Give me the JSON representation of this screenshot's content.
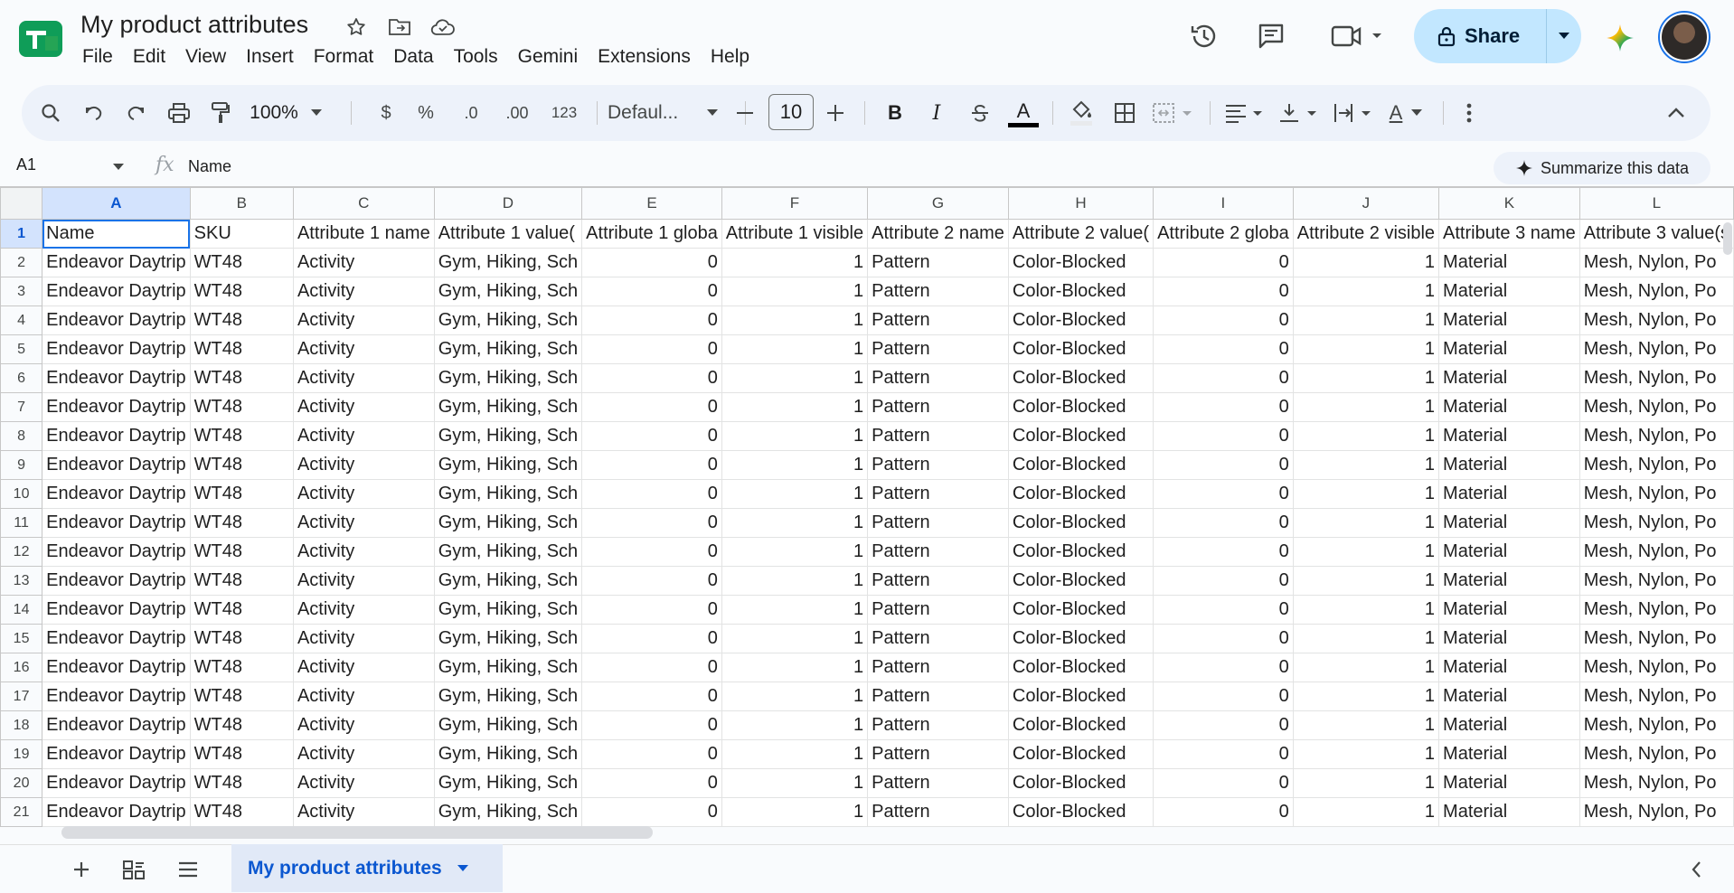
{
  "app": {
    "doc_title": "My product attributes",
    "menu": [
      "File",
      "Edit",
      "View",
      "Insert",
      "Format",
      "Data",
      "Tools",
      "Gemini",
      "Extensions",
      "Help"
    ],
    "share_label": "Share"
  },
  "toolbar": {
    "zoom": "100%",
    "currency": "$",
    "percent": "%",
    "dec_decrease": ".0",
    "dec_increase": ".00",
    "number_format": "123",
    "font": "Defaul...",
    "font_size": "10",
    "bold": "B",
    "italic": "I",
    "text_color_glyph": "A",
    "text_rotation_glyph": "A"
  },
  "formula_bar": {
    "cell_ref": "A1",
    "fx": "fx",
    "content": "Name",
    "summarize_label": "Summarize this data"
  },
  "grid": {
    "columns": [
      "A",
      "B",
      "C",
      "D",
      "E",
      "F",
      "G",
      "H",
      "I",
      "J",
      "K",
      "L"
    ],
    "header_row": [
      "Name",
      "SKU",
      "Attribute 1 name",
      "Attribute 1 value(",
      "Attribute 1 globa",
      "Attribute 1 visible",
      "Attribute 2 name",
      "Attribute 2 value(",
      "Attribute 2 globa",
      "Attribute 2 visible",
      "Attribute 3 name",
      "Attribute 3 value(s"
    ],
    "row_template": [
      "Endeavor Daytrip",
      "WT48",
      "Activity",
      "Gym, Hiking, Sch",
      "0",
      "1",
      "Pattern",
      "Color-Blocked",
      "0",
      "1",
      "Material",
      "Mesh, Nylon, Po"
    ],
    "row_numbers": [
      "1",
      "2",
      "3",
      "4",
      "5",
      "6",
      "7",
      "8",
      "9",
      "10",
      "11",
      "12",
      "13",
      "14",
      "15",
      "16",
      "17",
      "18",
      "19",
      "20",
      "21"
    ]
  },
  "sheets": {
    "active_tab": "My product attributes"
  },
  "colors": {
    "accent": "#0b57d0",
    "share_bg": "#c2e7ff",
    "selection_bg": "#d3e3fd",
    "logo_green": "#0f9d58"
  }
}
